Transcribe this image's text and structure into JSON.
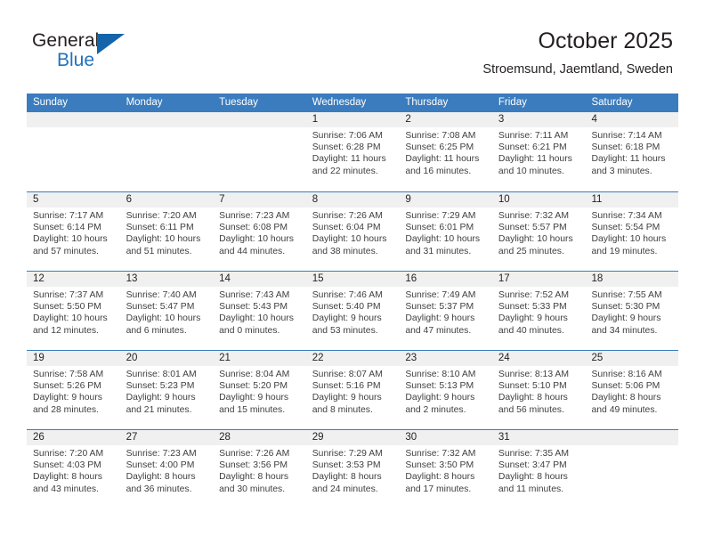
{
  "brand": {
    "name_top": "General",
    "name_bottom": "Blue",
    "flag_icon": "triangle-flag-icon",
    "accent_color": "#1464aa"
  },
  "header": {
    "title": "October 2025",
    "subtitle": "Stroemsund, Jaemtland, Sweden"
  },
  "theme": {
    "header_bg": "#3a7cbe",
    "header_text": "#ffffff",
    "day_band_bg": "#f0f0f0",
    "body_text": "#3f3f3f"
  },
  "weekdays": [
    "Sunday",
    "Monday",
    "Tuesday",
    "Wednesday",
    "Thursday",
    "Friday",
    "Saturday"
  ],
  "weeks": [
    [
      {
        "day": "",
        "sunrise": "",
        "sunset": "",
        "daylight1": "",
        "daylight2": "",
        "empty": true
      },
      {
        "day": "",
        "sunrise": "",
        "sunset": "",
        "daylight1": "",
        "daylight2": "",
        "empty": true
      },
      {
        "day": "",
        "sunrise": "",
        "sunset": "",
        "daylight1": "",
        "daylight2": "",
        "empty": true
      },
      {
        "day": "1",
        "sunrise": "Sunrise: 7:06 AM",
        "sunset": "Sunset: 6:28 PM",
        "daylight1": "Daylight: 11 hours",
        "daylight2": "and 22 minutes."
      },
      {
        "day": "2",
        "sunrise": "Sunrise: 7:08 AM",
        "sunset": "Sunset: 6:25 PM",
        "daylight1": "Daylight: 11 hours",
        "daylight2": "and 16 minutes."
      },
      {
        "day": "3",
        "sunrise": "Sunrise: 7:11 AM",
        "sunset": "Sunset: 6:21 PM",
        "daylight1": "Daylight: 11 hours",
        "daylight2": "and 10 minutes."
      },
      {
        "day": "4",
        "sunrise": "Sunrise: 7:14 AM",
        "sunset": "Sunset: 6:18 PM",
        "daylight1": "Daylight: 11 hours",
        "daylight2": "and 3 minutes."
      }
    ],
    [
      {
        "day": "5",
        "sunrise": "Sunrise: 7:17 AM",
        "sunset": "Sunset: 6:14 PM",
        "daylight1": "Daylight: 10 hours",
        "daylight2": "and 57 minutes."
      },
      {
        "day": "6",
        "sunrise": "Sunrise: 7:20 AM",
        "sunset": "Sunset: 6:11 PM",
        "daylight1": "Daylight: 10 hours",
        "daylight2": "and 51 minutes."
      },
      {
        "day": "7",
        "sunrise": "Sunrise: 7:23 AM",
        "sunset": "Sunset: 6:08 PM",
        "daylight1": "Daylight: 10 hours",
        "daylight2": "and 44 minutes."
      },
      {
        "day": "8",
        "sunrise": "Sunrise: 7:26 AM",
        "sunset": "Sunset: 6:04 PM",
        "daylight1": "Daylight: 10 hours",
        "daylight2": "and 38 minutes."
      },
      {
        "day": "9",
        "sunrise": "Sunrise: 7:29 AM",
        "sunset": "Sunset: 6:01 PM",
        "daylight1": "Daylight: 10 hours",
        "daylight2": "and 31 minutes."
      },
      {
        "day": "10",
        "sunrise": "Sunrise: 7:32 AM",
        "sunset": "Sunset: 5:57 PM",
        "daylight1": "Daylight: 10 hours",
        "daylight2": "and 25 minutes."
      },
      {
        "day": "11",
        "sunrise": "Sunrise: 7:34 AM",
        "sunset": "Sunset: 5:54 PM",
        "daylight1": "Daylight: 10 hours",
        "daylight2": "and 19 minutes."
      }
    ],
    [
      {
        "day": "12",
        "sunrise": "Sunrise: 7:37 AM",
        "sunset": "Sunset: 5:50 PM",
        "daylight1": "Daylight: 10 hours",
        "daylight2": "and 12 minutes."
      },
      {
        "day": "13",
        "sunrise": "Sunrise: 7:40 AM",
        "sunset": "Sunset: 5:47 PM",
        "daylight1": "Daylight: 10 hours",
        "daylight2": "and 6 minutes."
      },
      {
        "day": "14",
        "sunrise": "Sunrise: 7:43 AM",
        "sunset": "Sunset: 5:43 PM",
        "daylight1": "Daylight: 10 hours",
        "daylight2": "and 0 minutes."
      },
      {
        "day": "15",
        "sunrise": "Sunrise: 7:46 AM",
        "sunset": "Sunset: 5:40 PM",
        "daylight1": "Daylight: 9 hours",
        "daylight2": "and 53 minutes."
      },
      {
        "day": "16",
        "sunrise": "Sunrise: 7:49 AM",
        "sunset": "Sunset: 5:37 PM",
        "daylight1": "Daylight: 9 hours",
        "daylight2": "and 47 minutes."
      },
      {
        "day": "17",
        "sunrise": "Sunrise: 7:52 AM",
        "sunset": "Sunset: 5:33 PM",
        "daylight1": "Daylight: 9 hours",
        "daylight2": "and 40 minutes."
      },
      {
        "day": "18",
        "sunrise": "Sunrise: 7:55 AM",
        "sunset": "Sunset: 5:30 PM",
        "daylight1": "Daylight: 9 hours",
        "daylight2": "and 34 minutes."
      }
    ],
    [
      {
        "day": "19",
        "sunrise": "Sunrise: 7:58 AM",
        "sunset": "Sunset: 5:26 PM",
        "daylight1": "Daylight: 9 hours",
        "daylight2": "and 28 minutes."
      },
      {
        "day": "20",
        "sunrise": "Sunrise: 8:01 AM",
        "sunset": "Sunset: 5:23 PM",
        "daylight1": "Daylight: 9 hours",
        "daylight2": "and 21 minutes."
      },
      {
        "day": "21",
        "sunrise": "Sunrise: 8:04 AM",
        "sunset": "Sunset: 5:20 PM",
        "daylight1": "Daylight: 9 hours",
        "daylight2": "and 15 minutes."
      },
      {
        "day": "22",
        "sunrise": "Sunrise: 8:07 AM",
        "sunset": "Sunset: 5:16 PM",
        "daylight1": "Daylight: 9 hours",
        "daylight2": "and 8 minutes."
      },
      {
        "day": "23",
        "sunrise": "Sunrise: 8:10 AM",
        "sunset": "Sunset: 5:13 PM",
        "daylight1": "Daylight: 9 hours",
        "daylight2": "and 2 minutes."
      },
      {
        "day": "24",
        "sunrise": "Sunrise: 8:13 AM",
        "sunset": "Sunset: 5:10 PM",
        "daylight1": "Daylight: 8 hours",
        "daylight2": "and 56 minutes."
      },
      {
        "day": "25",
        "sunrise": "Sunrise: 8:16 AM",
        "sunset": "Sunset: 5:06 PM",
        "daylight1": "Daylight: 8 hours",
        "daylight2": "and 49 minutes."
      }
    ],
    [
      {
        "day": "26",
        "sunrise": "Sunrise: 7:20 AM",
        "sunset": "Sunset: 4:03 PM",
        "daylight1": "Daylight: 8 hours",
        "daylight2": "and 43 minutes."
      },
      {
        "day": "27",
        "sunrise": "Sunrise: 7:23 AM",
        "sunset": "Sunset: 4:00 PM",
        "daylight1": "Daylight: 8 hours",
        "daylight2": "and 36 minutes."
      },
      {
        "day": "28",
        "sunrise": "Sunrise: 7:26 AM",
        "sunset": "Sunset: 3:56 PM",
        "daylight1": "Daylight: 8 hours",
        "daylight2": "and 30 minutes."
      },
      {
        "day": "29",
        "sunrise": "Sunrise: 7:29 AM",
        "sunset": "Sunset: 3:53 PM",
        "daylight1": "Daylight: 8 hours",
        "daylight2": "and 24 minutes."
      },
      {
        "day": "30",
        "sunrise": "Sunrise: 7:32 AM",
        "sunset": "Sunset: 3:50 PM",
        "daylight1": "Daylight: 8 hours",
        "daylight2": "and 17 minutes."
      },
      {
        "day": "31",
        "sunrise": "Sunrise: 7:35 AM",
        "sunset": "Sunset: 3:47 PM",
        "daylight1": "Daylight: 8 hours",
        "daylight2": "and 11 minutes."
      },
      {
        "day": "",
        "sunrise": "",
        "sunset": "",
        "daylight1": "",
        "daylight2": "",
        "empty": true
      }
    ]
  ]
}
